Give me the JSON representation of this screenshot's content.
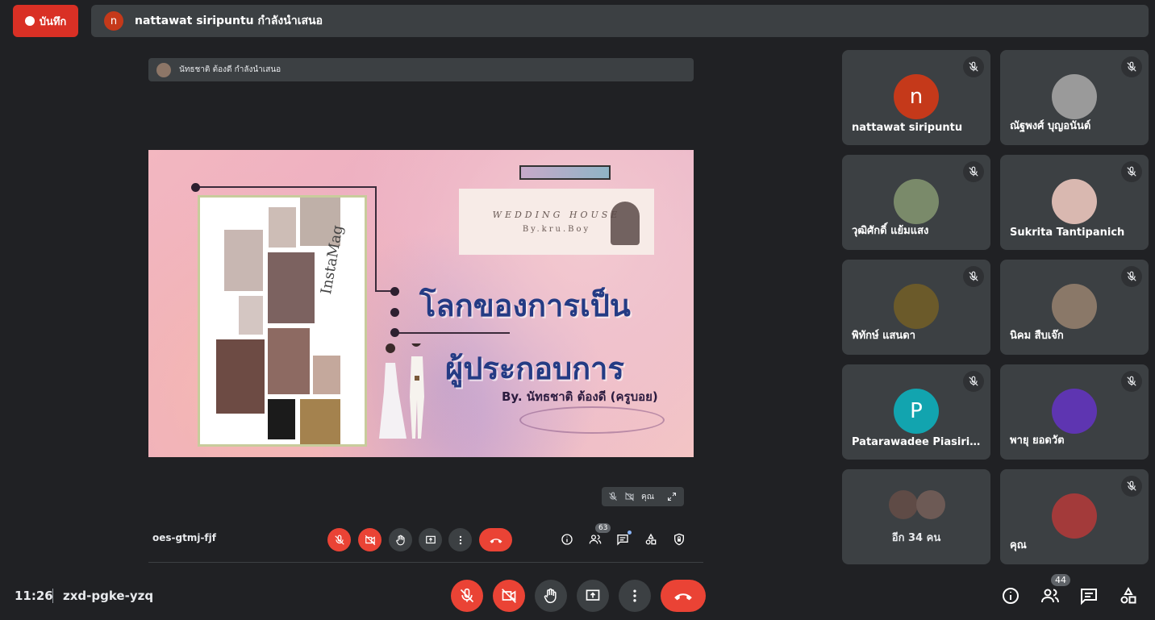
{
  "top_bar": {
    "record_label": "บันทึก",
    "presenter_initial": "n",
    "presenter_text": "nattawat siripuntu กำลังนำเสนอ"
  },
  "stage": {
    "inner_presenter_text": "นัทธชาติ ต้องดี กำลังนำเสนอ",
    "slide": {
      "logo_line1": "WEDDING HOUSE",
      "logo_line2": "By.kru.Boy",
      "frame_text": "InstaMag",
      "title_line1": "โลกของการเป็น",
      "title_line2": "ผู้ประกอบการ",
      "byline": "By. นัทธชาติ ต้องดี (ครูบอย)"
    },
    "self_label": "คุณ",
    "inner_meeting_code": "oes-gtmj-fjf",
    "inner_people_count": "63"
  },
  "participants": [
    {
      "name": "nattawat siripuntu",
      "initial": "n",
      "color": "#c5391a",
      "muted": true
    },
    {
      "name": "ณัฐพงศ์ บุญอนันต์",
      "initial": "",
      "color": "#9a9a9a",
      "muted": true
    },
    {
      "name": "วุฒิศักดิ์ แย้มแสง",
      "initial": "",
      "color": "#7a8a6a",
      "muted": true
    },
    {
      "name": "Sukrita Tantipanich",
      "initial": "",
      "color": "#d9b8b0",
      "muted": true
    },
    {
      "name": "พิทักษ์ แสนดา",
      "initial": "",
      "color": "#6b5a2a",
      "muted": true
    },
    {
      "name": "นิคม สืบเจ๊ก",
      "initial": "",
      "color": "#8a7868",
      "muted": true
    },
    {
      "name": "Patarawadee Piasirim...",
      "initial": "P",
      "color": "#12a4af",
      "muted": true
    },
    {
      "name": "พายุ ยอดวัต",
      "initial": "",
      "color": "#5e35b1",
      "muted": true
    },
    {
      "name": "อีก 34 คน",
      "initial": "",
      "color": "#5f4b46",
      "muted": false
    },
    {
      "name": "คุณ",
      "initial": "",
      "color": "#a33a3a",
      "muted": true
    }
  ],
  "bottom_bar": {
    "time": "11:26",
    "meeting_code": "zxd-pgke-yzq",
    "people_count": "44"
  },
  "colors": {
    "background": "#202124",
    "surface": "#3c4043",
    "danger": "#ea4335"
  }
}
